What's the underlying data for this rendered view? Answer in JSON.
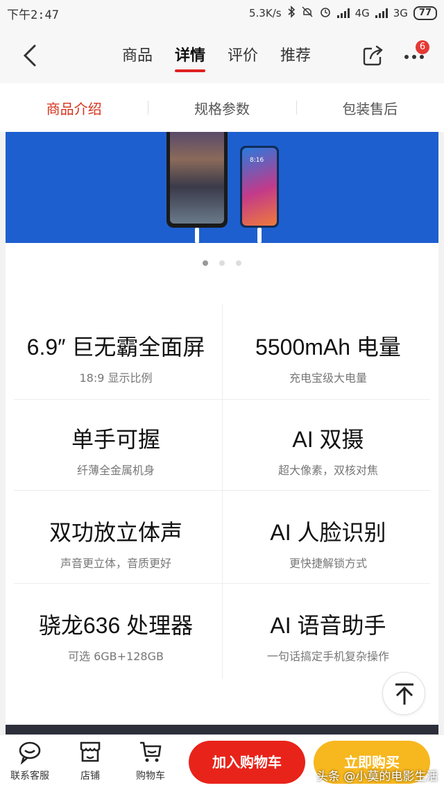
{
  "status_bar": {
    "time": "下午2:47",
    "speed": "5.3K/s",
    "network_1": "4G",
    "network_2": "3G",
    "battery": "77"
  },
  "nav": {
    "tabs": [
      {
        "label": "商品"
      },
      {
        "label": "详情"
      },
      {
        "label": "评价"
      },
      {
        "label": "推荐"
      }
    ],
    "active_tab": "详情",
    "badge_count": "6"
  },
  "subtabs": [
    {
      "label": "商品介绍"
    },
    {
      "label": "规格参数"
    },
    {
      "label": "包装售后"
    }
  ],
  "banner": {
    "phone_clock": "8:16"
  },
  "carousel": {
    "count": 3,
    "active": 0
  },
  "features": [
    {
      "title": "6.9″ 巨无霸全面屏",
      "subtitle": "18:9 显示比例"
    },
    {
      "title": "5500mAh 电量",
      "subtitle": "充电宝级大电量"
    },
    {
      "title": "单手可握",
      "subtitle": "纤薄全金属机身"
    },
    {
      "title": "AI 双摄",
      "subtitle": "超大像素，双核对焦"
    },
    {
      "title": "双功放立体声",
      "subtitle": "声音更立体，音质更好"
    },
    {
      "title": "AI 人脸识别",
      "subtitle": "更快捷解锁方式"
    },
    {
      "title": "骁龙636 处理器",
      "subtitle": "可选 6GB+128GB"
    },
    {
      "title": "AI 语音助手",
      "subtitle": "一句话搞定手机复杂操作"
    }
  ],
  "bottom_bar": {
    "service_label": "联系客服",
    "store_label": "店铺",
    "cart_label": "购物车",
    "add_to_cart": "加入购物车",
    "buy_now": "立即购买"
  },
  "watermark": "头条 @小莫的电影生活",
  "colors": {
    "accent_red": "#e8231a",
    "buy_yellow": "#f7b71e",
    "banner_blue": "#1e5fcf"
  }
}
